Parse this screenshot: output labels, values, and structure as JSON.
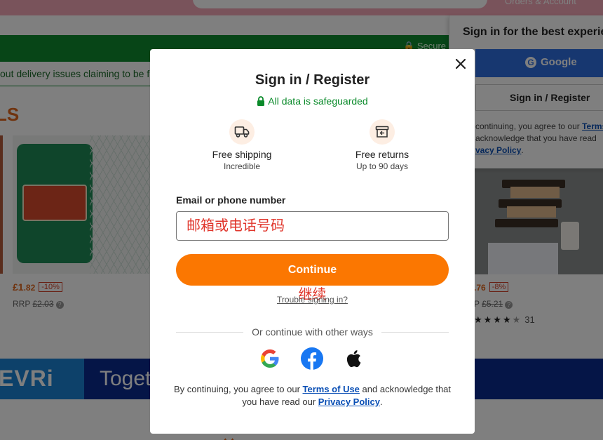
{
  "background": {
    "orders_label": "Orders & Account",
    "secure_label": "Secure",
    "notice_text": "out delivery issues claiming to be f",
    "deals_heading": "LS",
    "products": [
      {
        "price_main": "£1",
        "price_dec": ".82",
        "discount": "-10%",
        "rrp_label": "RRP",
        "rrp_price": "£2.03"
      },
      {
        "price_main": "",
        "price_dec": ".76",
        "discount": "-8%",
        "rrp_label": "P",
        "rrp_price": "£5.21",
        "stars": "★★★★",
        "half_star": "★",
        "rating_count": "31"
      }
    ],
    "banner_logo": "EVRi",
    "banner_text": "Toget",
    "bottom_peek": "♦ ♦"
  },
  "side_panel": {
    "title": "Sign in for the best experie",
    "google_label": "Google",
    "signin_label": "Sign in / Register",
    "legal_prefix": "continuing, you agree to our ",
    "legal_terms": "Terms",
    "legal_middle": "acknowledge that you have read",
    "legal_policy": "vacy Policy"
  },
  "modal": {
    "title": "Sign in / Register",
    "safe_text": "All data is safeguarded",
    "perks": [
      {
        "icon": "truck-icon",
        "title": "Free shipping",
        "subtitle": "Incredible"
      },
      {
        "icon": "return-box-icon",
        "title": "Free returns",
        "subtitle": "Up to 90 days"
      }
    ],
    "field_label": "Email or phone number",
    "field_placeholder": "邮箱或电话号码",
    "continue_label": "Continue",
    "continue_translation": "继续",
    "trouble_label": "Trouble signing in?",
    "divider_text": "Or continue with other ways",
    "legal_prefix": "By continuing, you agree to our ",
    "terms_label": "Terms of Use",
    "legal_middle": " and acknowledge that you have read our ",
    "privacy_label": "Privacy Policy",
    "legal_suffix": "."
  },
  "colors": {
    "accent": "#fb7701",
    "safe_green": "#0a8a2a",
    "link_blue": "#0a4fb5",
    "annotation_red": "#e0352b"
  }
}
